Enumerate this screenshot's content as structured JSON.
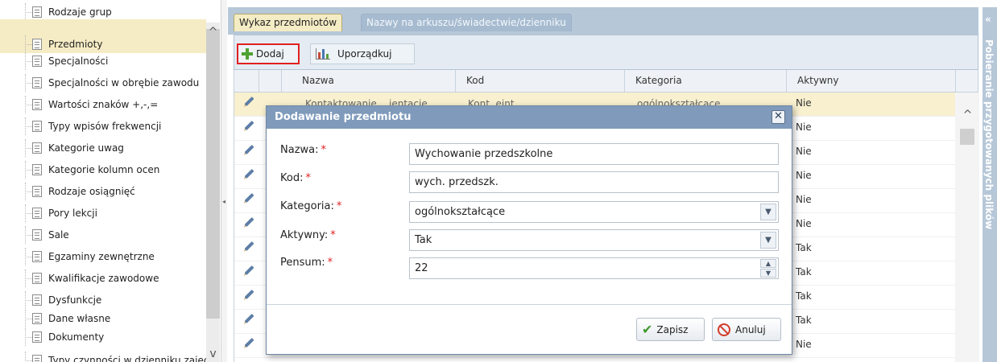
{
  "sidebar": {
    "items": [
      {
        "label": "Rodzaje grup",
        "selected": false
      },
      {
        "label": "Przedmioty",
        "selected": true
      },
      {
        "label": "Specjalności",
        "selected": false
      },
      {
        "label": "Specjalności w obrębie zawodu",
        "selected": false
      },
      {
        "label": "Wartości znaków +,-,=",
        "selected": false
      },
      {
        "label": "Typy wpisów frekwencji",
        "selected": false
      },
      {
        "label": "Kategorie uwag",
        "selected": false
      },
      {
        "label": "Kategorie kolumn ocen",
        "selected": false
      },
      {
        "label": "Rodzaje osiągnięć",
        "selected": false
      },
      {
        "label": "Pory lekcji",
        "selected": false
      },
      {
        "label": "Sale",
        "selected": false
      },
      {
        "label": "Egzaminy zewnętrzne",
        "selected": false
      },
      {
        "label": "Kwalifikacje zawodowe",
        "selected": false
      },
      {
        "label": "Dysfunkcje",
        "selected": false
      },
      {
        "label": "Dane własne",
        "selected": false
      },
      {
        "label": "Dokumenty",
        "selected": false
      },
      {
        "label": "Typy czynności w dzienniku zajęć",
        "selected": false
      }
    ],
    "scroll_up": "^",
    "scroll_down": "v"
  },
  "tabs": [
    {
      "label": "Wykaz przedmiotów",
      "active": true
    },
    {
      "label": "Nazwy na arkuszu/świadectwie/dzienniku",
      "active": false
    }
  ],
  "toolbar": {
    "add_label": "Dodaj",
    "sort_label": "Uporządkuj"
  },
  "grid": {
    "columns": [
      "Nazwa",
      "Kod",
      "Kategoria",
      "Aktywny"
    ],
    "aktywny_values": [
      "Nie",
      "Nie",
      "Nie",
      "Nie",
      "Nie",
      "Nie",
      "Tak",
      "Tak",
      "Tak",
      "Tak",
      "Nie"
    ],
    "first_row": {
      "nazwa": "Kontaktowanie ...ientacje",
      "kod": "Kont. ejnt.",
      "kategoria": "ogólnokształcące"
    }
  },
  "right_panel": {
    "collapse_glyph": "«",
    "label": "Pobieranie przygotowanych plików"
  },
  "modal": {
    "title": "Dodawanie przedmiotu",
    "close_glyph": "✕",
    "required_mark": "*",
    "fields": {
      "nazwa": {
        "label": "Nazwa:",
        "value": "Wychowanie przedszkolne"
      },
      "kod": {
        "label": "Kod:",
        "value": "wych. przedszk."
      },
      "kategoria": {
        "label": "Kategoria:",
        "value": "ogólnokształcące"
      },
      "aktywny": {
        "label": "Aktywny:",
        "value": "Tak"
      },
      "pensum": {
        "label": "Pensum:",
        "value": "22"
      }
    },
    "save_label": "Zapisz",
    "cancel_label": "Anuluj"
  },
  "colors": {
    "header_blue": "#b6c7d8",
    "modal_title": "#7f9abb",
    "selected_row": "#f5ecc5",
    "required": "#e02020",
    "add_highlight": "#e02020"
  }
}
